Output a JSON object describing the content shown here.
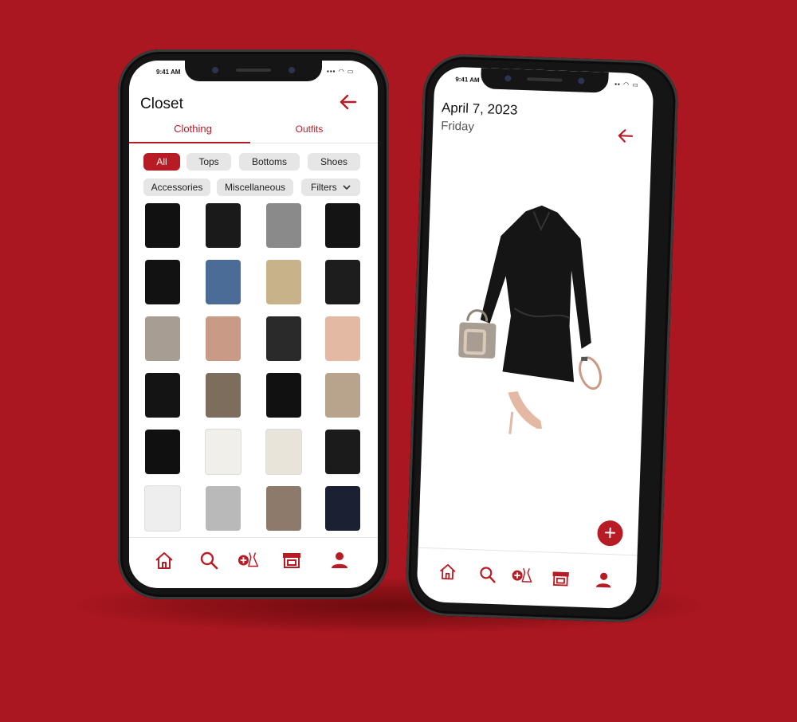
{
  "closet_screen": {
    "status_time": "9:41 AM",
    "title": "Closet",
    "tabs": [
      {
        "label": "Clothing",
        "active": true
      },
      {
        "label": "Outfits",
        "active": false
      }
    ],
    "filters_row1": [
      "All",
      "Tops",
      "Bottoms",
      "Shoes"
    ],
    "filters_row2": [
      "Accessories",
      "Miscellaneous"
    ],
    "filters_dropdown": "Filters",
    "grid_items": [
      {
        "icon": "black-mini-dress",
        "color": "#111111"
      },
      {
        "icon": "black-strappy-heels",
        "color": "#1a1a1a"
      },
      {
        "icon": "gray-tube-top",
        "color": "#8a8a8a"
      },
      {
        "icon": "black-leather-jacket",
        "color": "#141414"
      },
      {
        "icon": "black-slip-dress",
        "color": "#121212"
      },
      {
        "icon": "blue-jeans",
        "color": "#4a6c96"
      },
      {
        "icon": "gold-sequin-camisole",
        "color": "#c8b28a"
      },
      {
        "icon": "black-lace-top",
        "color": "#1d1d1d"
      },
      {
        "icon": "taupe-handbag",
        "color": "#a89d92"
      },
      {
        "icon": "rose-gold-bracelet",
        "color": "#c99b86"
      },
      {
        "icon": "clear-black-heels",
        "color": "#2a2a2a"
      },
      {
        "icon": "nude-pumps",
        "color": "#e4b9a4"
      },
      {
        "icon": "black-satin-dress",
        "color": "#141414"
      },
      {
        "icon": "snake-print-skirt",
        "color": "#7d6d5c"
      },
      {
        "icon": "black-handbag",
        "color": "#111111"
      },
      {
        "icon": "beige-cropped-trench",
        "color": "#b8a38c"
      },
      {
        "icon": "black-sunglasses",
        "color": "#101010"
      },
      {
        "icon": "white-peplum-top",
        "color": "#f1efea"
      },
      {
        "icon": "cream-trousers",
        "color": "#e9e4da"
      },
      {
        "icon": "black-sandals",
        "color": "#1b1b1b"
      },
      {
        "icon": "white-sneakers",
        "color": "#eeeeee"
      },
      {
        "icon": "silver-watch",
        "color": "#b9b9b9"
      },
      {
        "icon": "floral-blouse",
        "color": "#8e7a6a"
      },
      {
        "icon": "navy-puffer-vest",
        "color": "#1b2033"
      }
    ],
    "nav": [
      "home-icon",
      "search-icon",
      "add-outfit-icon",
      "store-icon",
      "profile-icon"
    ]
  },
  "outfit_screen": {
    "status_time": "9:41 AM",
    "date": "April 7, 2023",
    "weekday": "Friday",
    "outfit_pieces": [
      {
        "icon": "black-satin-dress",
        "color": "#151515"
      },
      {
        "icon": "taupe-handbag",
        "color": "#a89d92"
      },
      {
        "icon": "rose-gold-bracelet",
        "color": "#c99b86"
      },
      {
        "icon": "nude-pumps",
        "color": "#e4b9a4"
      }
    ],
    "fab_label": "+",
    "nav": [
      "home-icon",
      "search-icon",
      "add-outfit-icon",
      "store-icon",
      "profile-icon"
    ]
  },
  "colors": {
    "brand": "#b71b23",
    "background": "#ab1720"
  }
}
